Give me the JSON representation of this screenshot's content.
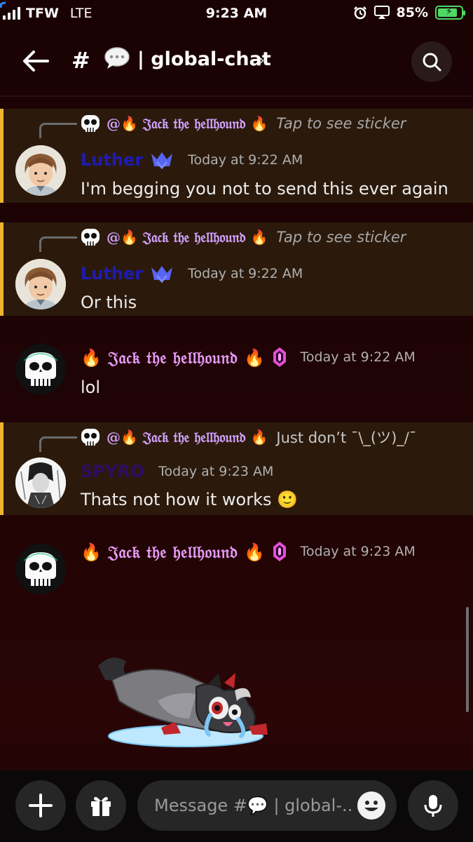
{
  "status": {
    "carrier": "TFW",
    "network": "LTE",
    "time": "9:23 AM",
    "battery": "85%",
    "battery_level": 0.85
  },
  "header": {
    "hash": "#",
    "channel_name": "| global-chat",
    "chevron": "›"
  },
  "messages": [
    {
      "reply_mention": "@🔥 𝔍𝔞𝔠𝔨 𝔱𝔥𝔢 𝔥𝔢𝔩𝔩𝔥𝔬𝔲𝔫𝔡 🔥",
      "reply_text": "Tap to see sticker",
      "author": "Luther",
      "timestamp": "Today at 9:22 AM",
      "text": "I'm begging you not to send this ever again"
    },
    {
      "reply_mention": "@🔥 𝔍𝔞𝔠𝔨 𝔱𝔥𝔢 𝔥𝔢𝔩𝔩𝔥𝔬𝔲𝔫𝔡 🔥",
      "reply_text": "Tap to see sticker",
      "author": "Luther",
      "timestamp": "Today at 9:22 AM",
      "text": "Or this"
    },
    {
      "author": "🔥 𝔍𝔞𝔠𝔨 𝔱𝔥𝔢 𝔥𝔢𝔩𝔩𝔥𝔬𝔲𝔫𝔡 🔥",
      "timestamp": "Today at 9:22 AM",
      "text": "lol"
    },
    {
      "reply_mention": "@🔥 𝔍𝔞𝔠𝔨 𝔱𝔥𝔢 𝔥𝔢𝔩𝔩𝔥𝔬𝔲𝔫𝔡 🔥",
      "reply_text": "Just don’t ¯\\_(ツ)_/¯",
      "author": "SPYRO",
      "timestamp": "Today at 9:23 AM",
      "text": "Thats not how it works 🙂"
    },
    {
      "author": "🔥 𝔍𝔞𝔠𝔨 𝔱𝔥𝔢 𝔥𝔢𝔩𝔩𝔥𝔬𝔲𝔫𝔡 🔥",
      "timestamp": "Today at 9:23 AM"
    }
  ],
  "composer": {
    "placeholder": "Message #💬 | global-.."
  },
  "icons": {
    "back": "back-arrow-icon",
    "search": "search-icon",
    "add": "plus-icon",
    "gift": "gift-icon",
    "emoji": "emoji-icon",
    "mic": "microphone-icon",
    "speech": "speech-bubble-icon"
  },
  "colors": {
    "highlight_bar": "#f0b232",
    "highlight_bg": "#2b1a0c",
    "luther_name": "#1e1bb3",
    "jack_name": "#e79cf7",
    "battery": "#4cd964"
  }
}
